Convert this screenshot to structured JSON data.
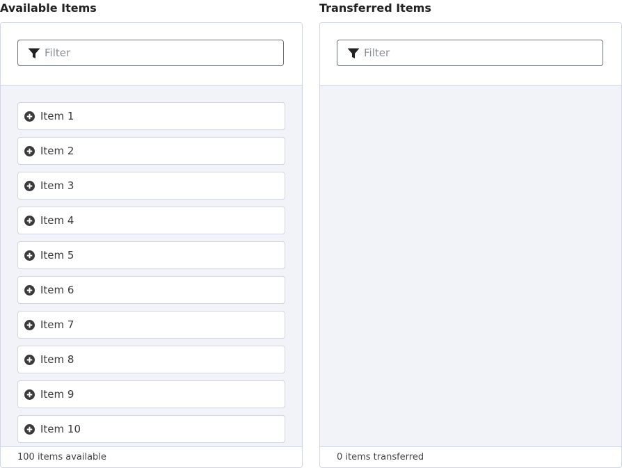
{
  "available": {
    "heading": "Available Items",
    "filter_placeholder": "Filter",
    "items": [
      {
        "label": "Item 1"
      },
      {
        "label": "Item 2"
      },
      {
        "label": "Item 3"
      },
      {
        "label": "Item 4"
      },
      {
        "label": "Item 5"
      },
      {
        "label": "Item 6"
      },
      {
        "label": "Item 7"
      },
      {
        "label": "Item 8"
      },
      {
        "label": "Item 9"
      },
      {
        "label": "Item 10"
      }
    ],
    "item_icon": "plus-circle-icon",
    "footer": "100 items available"
  },
  "transferred": {
    "heading": "Transferred Items",
    "filter_placeholder": "Filter",
    "items": [],
    "footer": "0 items transferred"
  },
  "colors": {
    "panel_border": "#d2d6e0",
    "list_background": "#f2f3f8",
    "icon": "#3a3a3a"
  }
}
